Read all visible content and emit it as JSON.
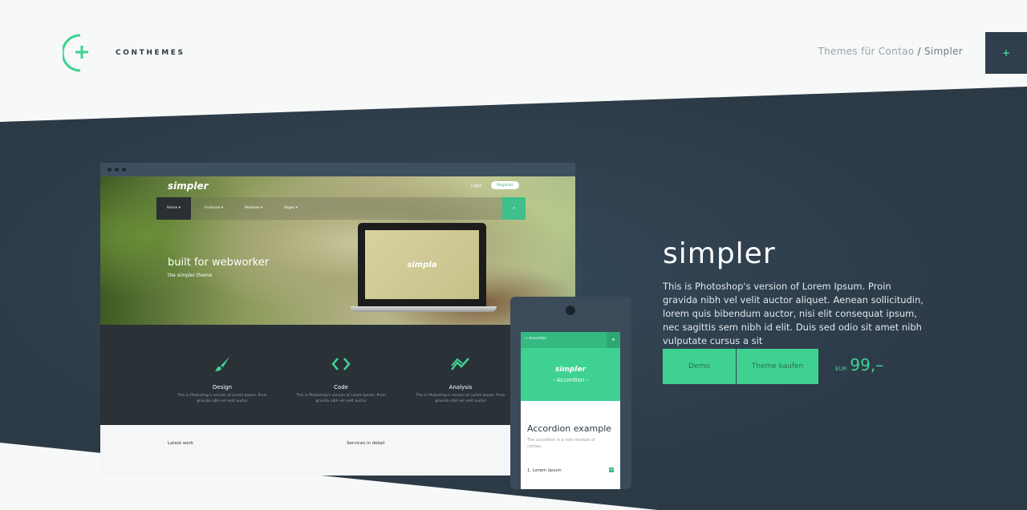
{
  "header": {
    "brand": "CONTHEMES",
    "breadcrumb": {
      "parent": "Themes für Contao",
      "separator": "/",
      "current": "Simpler"
    },
    "menu_icon": "+"
  },
  "colors": {
    "dark": "#2e3e4c",
    "accent": "#3fd192",
    "background": "#f7f8f8"
  },
  "browser_mock": {
    "site_logo": "simpler",
    "login": "Login",
    "register": "Register",
    "nav": [
      "Home",
      "Features",
      "Modules",
      "Pages"
    ],
    "hero_title": "built for webworker",
    "hero_subtitle": "the simpler theme",
    "laptop_logo": "simpla",
    "features": [
      {
        "title": "Design",
        "text": "This is Photoshop's version  of Lorem Ipsum. Proin gravida nibh vel velit auctor",
        "icon": "brush-icon"
      },
      {
        "title": "Code",
        "text": "This is Photoshop's version  of Lorem Ipsum. Proin gravida nibh vel velit auctor",
        "icon": "code-icon"
      },
      {
        "title": "Analysis",
        "text": "This is Photoshop's version  of Lorem Ipsum. Proin gravida nibh vel velit auctor",
        "icon": "chart-icon"
      }
    ],
    "lower_left": "Latest work",
    "lower_right": "Services in detail"
  },
  "phone_mock": {
    "top_label": "→ Accordion",
    "menu": "≡",
    "logo": "simpler",
    "subtitle": "- Accordion -",
    "title": "Accordion example",
    "desc": "The accordion is a core module of contao.",
    "item": "1. Lorem Ipsum",
    "item_icon": "+"
  },
  "product": {
    "title": "simpler",
    "description": "This is Photoshop's version  of Lorem Ipsum. Proin gravida nibh vel velit auctor aliquet. Aenean sollicitudin, lorem quis bibendum auctor, nisi elit consequat ipsum, nec sagittis sem nibh id elit. Duis sed odio sit amet nibh vulputate cursus a sit",
    "demo_label": "Demo",
    "buy_label": "Theme kaufen",
    "currency": "EUR",
    "price": "99,–"
  }
}
